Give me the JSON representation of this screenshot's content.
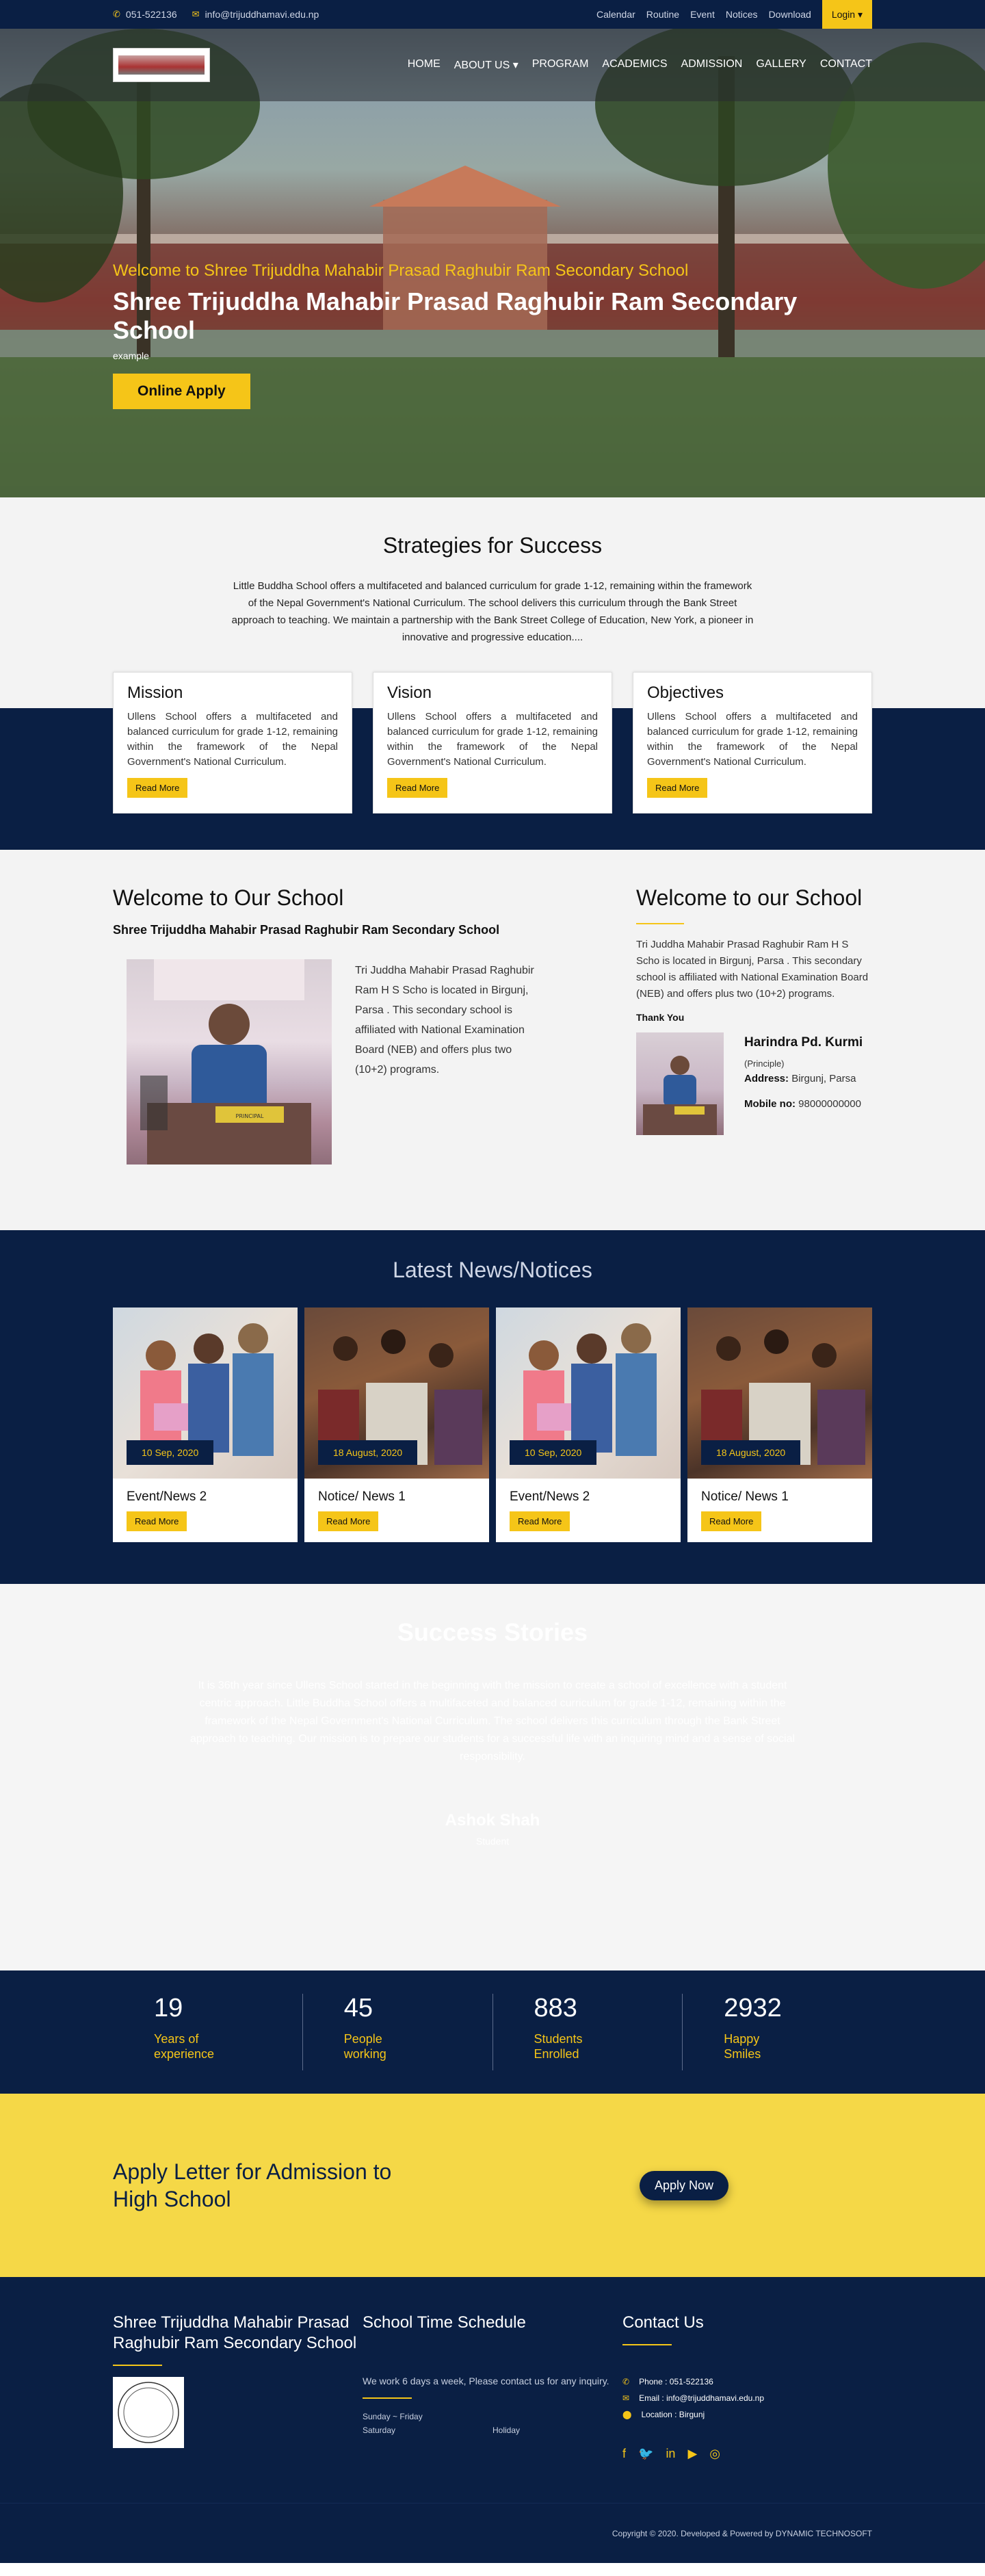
{
  "topbar": {
    "phone": "051-522136",
    "email": "info@trijuddhamavi.edu.np",
    "links": [
      "Calendar",
      "Routine",
      "Event",
      "Notices",
      "Download"
    ],
    "login": "Login ▾"
  },
  "nav": {
    "items": [
      "HOME",
      "ABOUT US ▾",
      "PROGRAM",
      "ACADEMICS",
      "ADMISSION",
      "GALLERY",
      "CONTACT"
    ]
  },
  "hero": {
    "subtitle": "Welcome to Shree Trijuddha Mahabir Prasad Raghubir Ram Secondary School",
    "title": "Shree Trijuddha Mahabir Prasad Raghubir Ram Secondary School",
    "example": "example",
    "button": "Online Apply"
  },
  "strategies": {
    "title": "Strategies for Success",
    "text": "Little Buddha School offers a multifaceted and balanced curriculum for grade 1-12, remaining within the framework of the Nepal Government's National Curriculum. The school delivers this curriculum through the Bank Street approach to teaching. We maintain a partnership with the Bank Street College of Education, New York, a pioneer in innovative and progressive education....",
    "cards": [
      {
        "title": "Mission",
        "text": "Ullens School offers a multifaceted and balanced curriculum for grade 1-12, remaining within the framework of the Nepal Government's National Curriculum.",
        "button": "Read More"
      },
      {
        "title": "Vision",
        "text": "Ullens School offers a multifaceted and balanced curriculum for grade 1-12, remaining within the framework of the Nepal Government's National Curriculum.",
        "button": "Read More"
      },
      {
        "title": "Objectives",
        "text": "Ullens School offers a multifaceted and balanced curriculum for grade 1-12, remaining within the framework of the Nepal Government's National Curriculum.",
        "button": "Read More"
      }
    ]
  },
  "welcome": {
    "title": "Welcome to Our School",
    "school": "Shree Trijuddha Mahabir Prasad Raghubir Ram Secondary School",
    "text": "Tri Juddha Mahabir Prasad Raghubir Ram H S Scho is located in Birgunj, Parsa . This secondary school is affiliated with National Examination Board (NEB) and offers plus two (10+2) programs.",
    "photo_label": "PRINCIPAL"
  },
  "welcome_right": {
    "title": "Welcome to our School",
    "text": "Tri Juddha Mahabir Prasad Raghubir Ram H S Scho is located in Birgunj, Parsa . This secondary school is affiliated with National Examination Board (NEB) and offers plus two (10+2) programs.",
    "thanks": "Thank You",
    "name": "Harindra Pd. Kurmi",
    "role": "(Principle)",
    "address_label": "Address:",
    "address": "Birgunj, Parsa",
    "mobile_label": "Mobile no:",
    "mobile": "98000000000"
  },
  "news": {
    "title": "Latest News/Notices",
    "items": [
      {
        "date": "10 Sep, 2020",
        "title": "Event/News 2",
        "button": "Read More"
      },
      {
        "date": "18 August, 2020",
        "title": "Notice/ News 1",
        "button": "Read More"
      },
      {
        "date": "10 Sep, 2020",
        "title": "Event/News 2",
        "button": "Read More"
      },
      {
        "date": "18 August, 2020",
        "title": "Notice/ News 1",
        "button": "Read More"
      }
    ]
  },
  "success": {
    "title": "Success Stories",
    "text": "It is 36th year since Ullens School started in the beginning with the mission to create a school of excellence with a student centric approach. Little Buddha School offers a multifaceted and balanced curriculum for grade 1-12, remaining within the framework of the Nepal Government's National Curriculum. The school delivers this curriculum through the Bank Street approach to teaching. Our mission is to prepare our students for a successful life with an inquiring mind and a sense of social responsibility.",
    "name": "Ashok Shah",
    "role": "Student"
  },
  "stats": [
    {
      "number": "19",
      "label": "Years of experience"
    },
    {
      "number": "45",
      "label": "People working"
    },
    {
      "number": "883",
      "label": "Students Enrolled"
    },
    {
      "number": "2932",
      "label": "Happy Smiles"
    }
  ],
  "apply": {
    "title": "Apply Letter for Admission to High School",
    "button": "Apply Now"
  },
  "footer": {
    "col1_title": "Shree Trijuddha Mahabir Prasad Raghubir Ram Secondary School",
    "col2_title": "School Time Schedule",
    "col2_text": "We work 6 days a week, Please contact us for any inquiry.",
    "days": "Sunday ~ Friday",
    "saturday": "Saturday",
    "holiday": "Holiday",
    "col3_title": "Contact Us",
    "phone": "Phone : 051-522136",
    "email": "Email : info@trijuddhamavi.edu.np",
    "location": "Location : Birgunj",
    "copyright": "Copyright © 2020. Developed & Powered by DYNAMIC TECHNOSOFT"
  },
  "colors": {
    "navy": "#0a1f44",
    "yellow": "#f5c518",
    "band_yellow": "#f5d847"
  },
  "icons": [
    "phone-icon",
    "mail-icon",
    "map-marker-icon",
    "facebook-icon",
    "twitter-icon",
    "linkedin-icon",
    "youtube-icon",
    "instagram-icon"
  ]
}
